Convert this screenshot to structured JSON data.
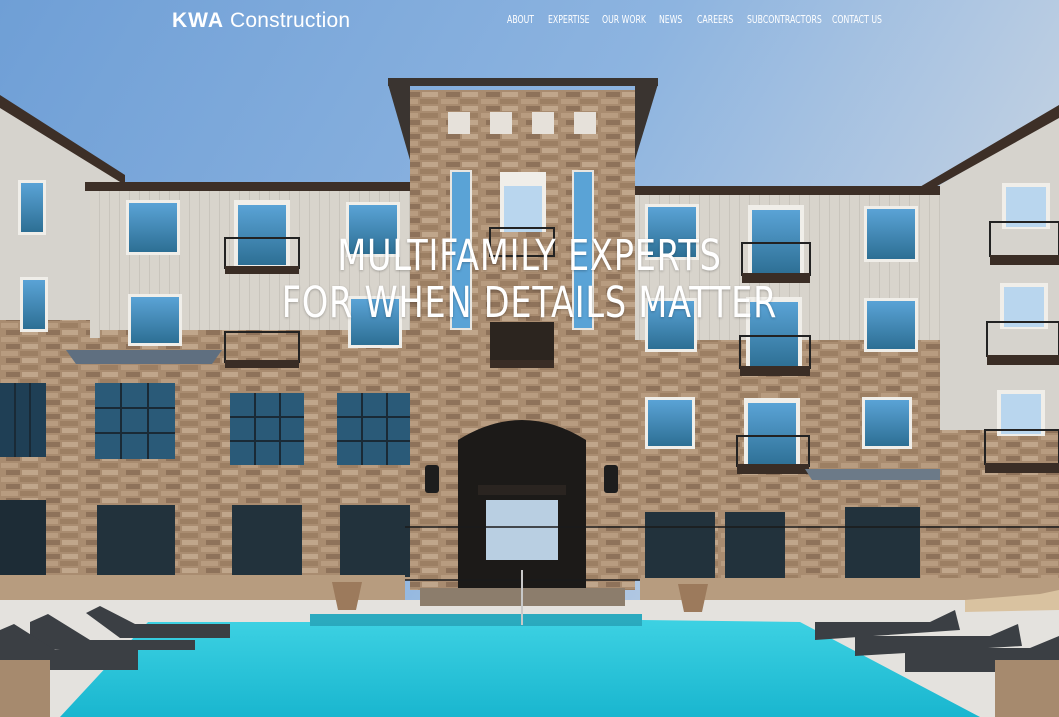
{
  "header": {
    "logo": {
      "bold": "KWA",
      "light": "Construction"
    },
    "nav": [
      {
        "label": "ABOUT"
      },
      {
        "label": "EXPERTISE"
      },
      {
        "label": "OUR WORK"
      },
      {
        "label": "NEWS"
      },
      {
        "label": "CAREERS"
      },
      {
        "label": "SUBCONTRACTORS"
      },
      {
        "label": "CONTACT US"
      }
    ]
  },
  "hero": {
    "headline_line1": "MULTIFAMILY EXPERTS",
    "headline_line2": "FOR WHEN DETAILS MATTER",
    "image_description": "Multifamily apartment building with stone and siding facade behind a turquoise swimming pool"
  },
  "colors": {
    "sky": "#7fa9d6",
    "stone": "#a68a6e",
    "siding": "#d9d6cf",
    "pool": "#27c3d6",
    "trim": "#3b2f28"
  }
}
